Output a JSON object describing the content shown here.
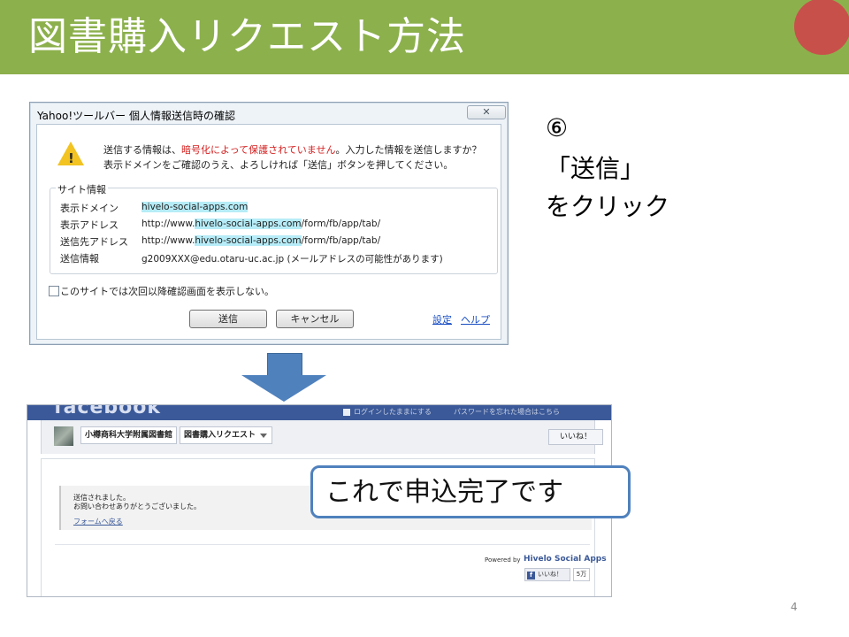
{
  "slide": {
    "title": "図書購入リクエスト方法",
    "page_number": "4"
  },
  "dialog": {
    "title": "Yahoo!ツールバー 個人情報送信時の確認",
    "close_label": "✕",
    "warning_line1_prefix": "送信する情報は、",
    "warning_line1_red": "暗号化によって保護されていません",
    "warning_line1_suffix": "。入力した情報を送信しますか？",
    "warning_line2": "表示ドメインをご確認のうえ、よろしければ「送信」ボタンを押してください。",
    "site_info_legend": "サイト情報",
    "rows": {
      "domain_label": "表示ドメイン",
      "domain_value": "hivelo-social-apps.com",
      "address_label": "表示アドレス",
      "address_prefix": "http://www.",
      "address_highlight": "hivelo-social-apps.com",
      "address_suffix": "/form/fb/app/tab/",
      "dest_label": "送信先アドレス",
      "dest_prefix": "http://www.",
      "dest_highlight": "hivelo-social-apps.com",
      "dest_suffix": "/form/fb/app/tab/",
      "info_label": "送信情報",
      "info_value": "g2009XXX@edu.otaru-uc.ac.jp (メールアドレスの可能性があります)"
    },
    "checkbox_label": "このサイトでは次回以降確認画面を表示しない。",
    "send_button": "送信",
    "cancel_button": "キャンセル",
    "settings_link": "設定",
    "help_link": "ヘルプ"
  },
  "instruction": {
    "step": "⑥",
    "line1": "「送信」",
    "line2": "をクリック"
  },
  "facebook": {
    "logo": "facebook",
    "top_checkbox_text": "ログインしたままにする",
    "top_forgot_text": "パスワードを忘れた場合はこちら",
    "crumb_library": "小樽商科大学附属図書館",
    "crumb_request": "図書購入リクエスト",
    "like_top": "いいね！",
    "message_line1": "送信されました。",
    "message_line2": "お問い合わせありがとうございました。",
    "form_link": "フォームへ戻る",
    "powered_by": "Powered by",
    "powered_brand": "Hivelo Social Apps",
    "like_button": "いいね！",
    "like_count": "5万",
    "like_f": "f"
  },
  "callout": {
    "text": "これで申込完了です"
  },
  "colors": {
    "title_bar": "#8cb04c",
    "decor_circle": "#c8504b",
    "arrow": "#4f81bd",
    "facebook_blue": "#3b5998"
  }
}
